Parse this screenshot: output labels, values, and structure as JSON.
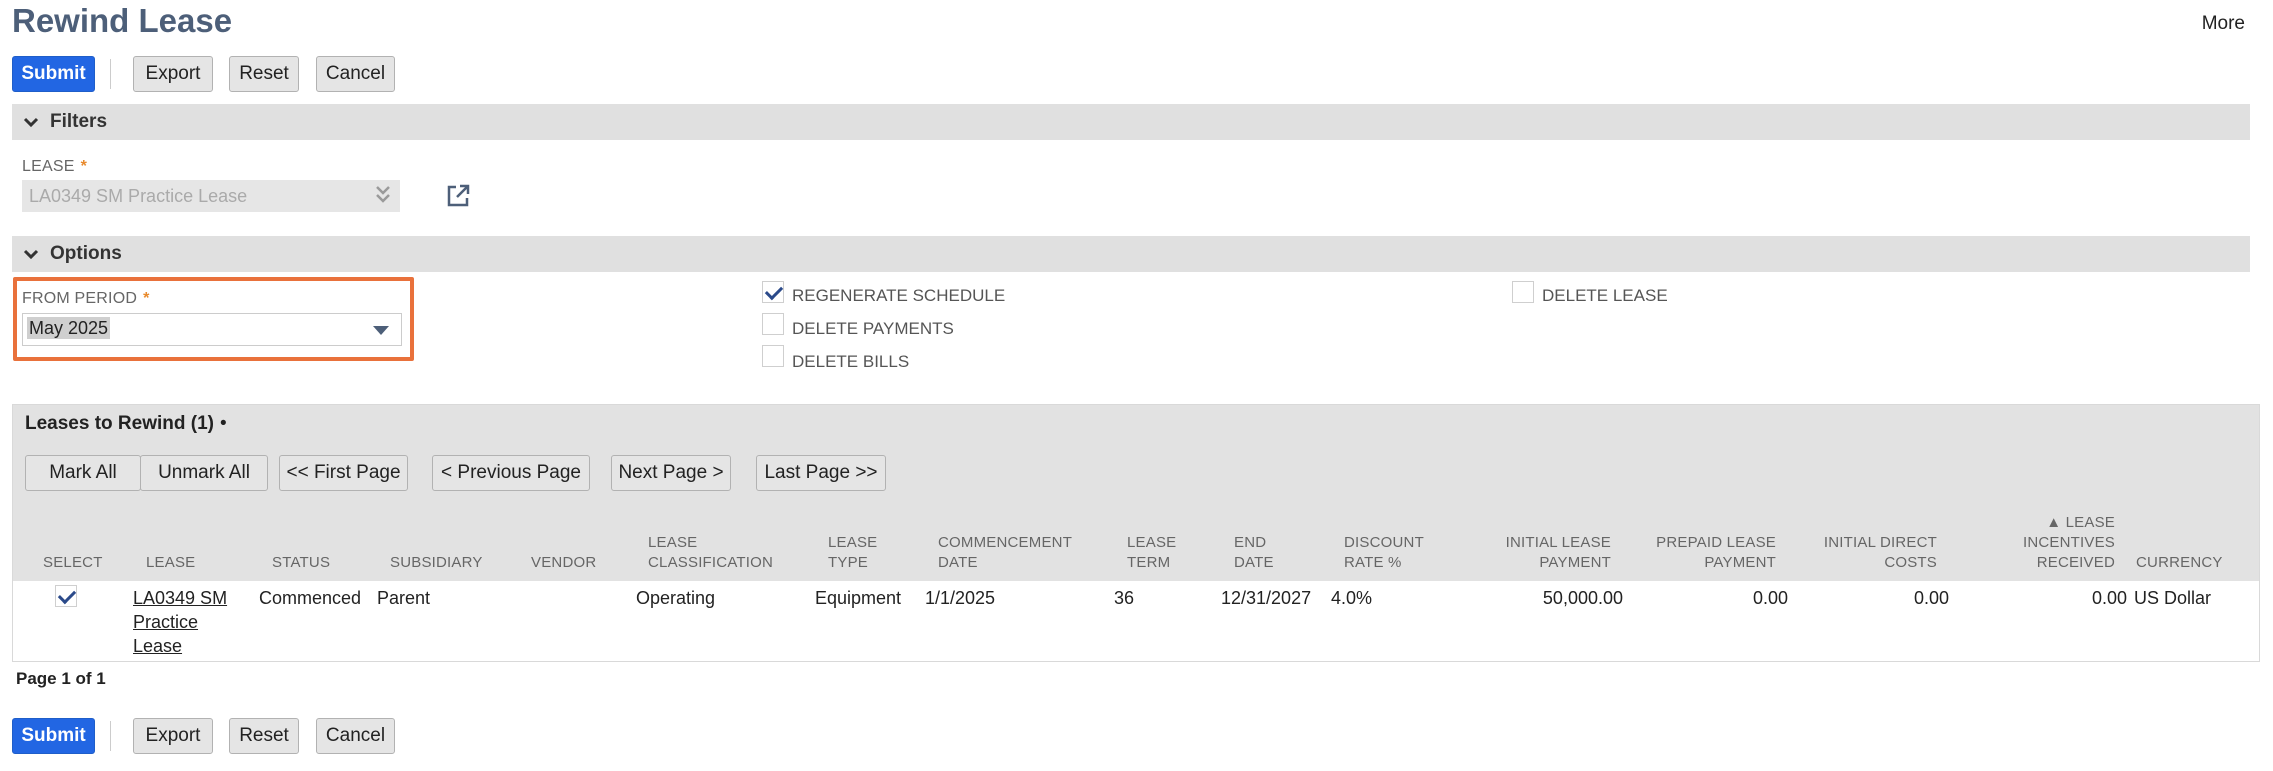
{
  "page": {
    "title": "Rewind Lease",
    "more_label": "More"
  },
  "actions": {
    "submit": "Submit",
    "export": "Export",
    "reset": "Reset",
    "cancel": "Cancel"
  },
  "filters": {
    "section_title": "Filters",
    "lease_label": "LEASE",
    "required_mark": "*",
    "lease_value": "LA0349 SM Practice Lease"
  },
  "options": {
    "section_title": "Options",
    "from_period_label": "FROM PERIOD",
    "from_period_value": "May 2025",
    "checkboxes": [
      {
        "label": "REGENERATE SCHEDULE",
        "checked": true
      },
      {
        "label": "DELETE PAYMENTS",
        "checked": false
      },
      {
        "label": "DELETE BILLS",
        "checked": false
      },
      {
        "label": "DELETE LEASE",
        "checked": false
      }
    ]
  },
  "list": {
    "title": "Leases to Rewind (1)",
    "title_suffix": "•",
    "buttons": {
      "mark_all": "Mark All",
      "unmark_all": "Unmark All",
      "first_page": "<< First Page",
      "previous_page": "< Previous Page",
      "next_page": "Next Page >",
      "last_page": "Last Page >>"
    },
    "columns": {
      "select": "SELECT",
      "lease": "LEASE",
      "status": "STATUS",
      "subsidiary": "SUBSIDIARY",
      "vendor": "VENDOR",
      "classification_1": "LEASE",
      "classification_2": "CLASSIFICATION",
      "type_1": "LEASE",
      "type_2": "TYPE",
      "commencement_1": "COMMENCEMENT",
      "commencement_2": "DATE",
      "term_1": "LEASE",
      "term_2": "TERM",
      "end_1": "END",
      "end_2": "DATE",
      "discount_1": "DISCOUNT",
      "discount_2": "RATE %",
      "initial_payment_1": "INITIAL LEASE",
      "initial_payment_2": "PAYMENT",
      "prepaid_1": "PREPAID LEASE",
      "prepaid_2": "PAYMENT",
      "direct_costs_1": "INITIAL DIRECT",
      "direct_costs_2": "COSTS",
      "incentives_1": "▲ LEASE",
      "incentives_2": "INCENTIVES",
      "incentives_3": "RECEIVED",
      "currency": "CURRENCY"
    },
    "rows": [
      {
        "selected": true,
        "lease_1": "LA0349 SM",
        "lease_2": "Practice",
        "lease_3": "Lease",
        "status": "Commenced",
        "subsidiary": "Parent",
        "vendor": "",
        "classification": "Operating",
        "type": "Equipment",
        "commencement": "1/1/2025",
        "term": "36",
        "end_date": "12/31/2027",
        "discount": "4.0%",
        "initial_payment": "50,000.00",
        "prepaid": "0.00",
        "direct_costs": "0.00",
        "incentives": "0.00",
        "currency": "US Dollar"
      }
    ],
    "page_info": "Page 1 of 1"
  },
  "colors": {
    "accent": "#2266e3",
    "title": "#4d5f79",
    "highlight": "#e9713b",
    "section_bar": "#e0e0e0"
  }
}
